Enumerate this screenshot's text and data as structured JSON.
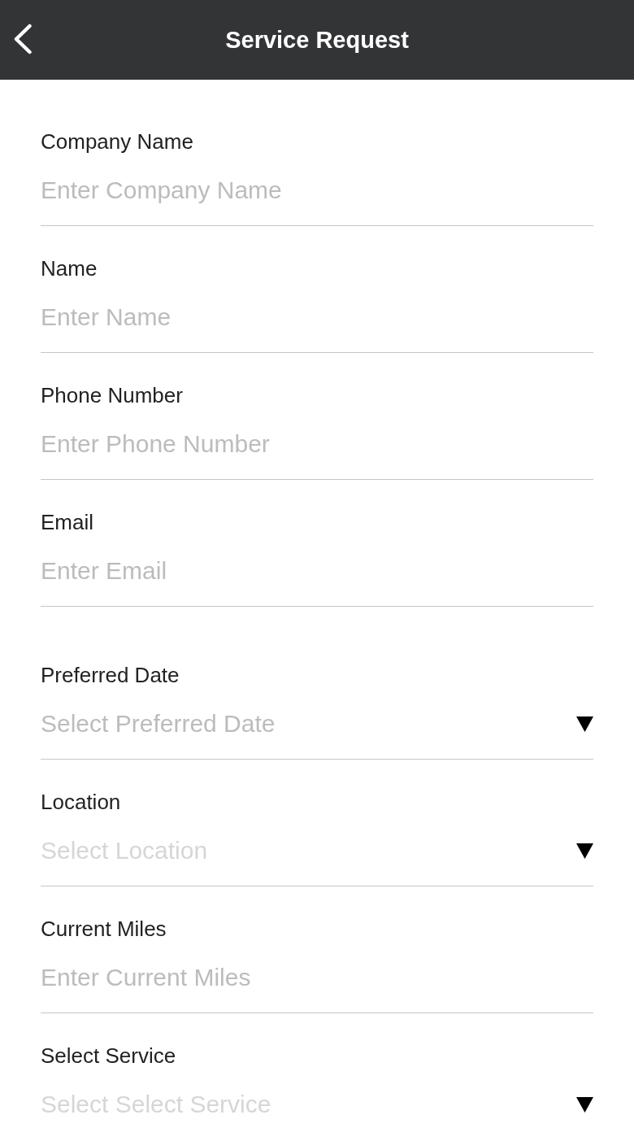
{
  "header": {
    "title": "Service Request"
  },
  "sections": [
    {
      "fields": [
        {
          "label": "Company Name",
          "kind": "text",
          "placeholder": "Enter Company Name",
          "disabled": false
        },
        {
          "label": "Name",
          "kind": "text",
          "placeholder": "Enter Name",
          "disabled": false
        },
        {
          "label": "Phone Number",
          "kind": "text",
          "placeholder": "Enter Phone Number",
          "disabled": false
        },
        {
          "label": "Email",
          "kind": "text",
          "placeholder": "Enter Email",
          "disabled": false
        }
      ]
    },
    {
      "fields": [
        {
          "label": "Preferred Date",
          "kind": "select",
          "placeholder": "Select Preferred Date",
          "disabled": false
        },
        {
          "label": "Location",
          "kind": "select",
          "placeholder": "Select Location",
          "disabled": true
        },
        {
          "label": "Current Miles",
          "kind": "text",
          "placeholder": "Enter Current Miles",
          "disabled": false
        },
        {
          "label": "Select Service",
          "kind": "select",
          "placeholder": "Select Select Service",
          "disabled": true
        }
      ]
    }
  ]
}
